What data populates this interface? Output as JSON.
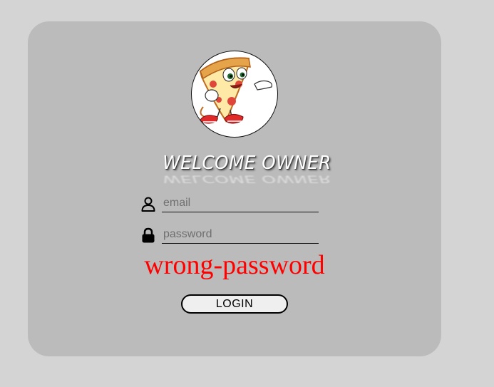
{
  "header": {
    "title": "WELCOME OWNER"
  },
  "logo": {
    "icon": "pizza-mascot-icon"
  },
  "form": {
    "email": {
      "placeholder": "email",
      "value": "",
      "icon": "user-icon"
    },
    "password": {
      "placeholder": "password",
      "value": "",
      "icon": "lock-icon"
    },
    "error_message": "wrong-password",
    "login_label": "LOGIN"
  },
  "colors": {
    "page_background": "#d4d4d4",
    "card_background": "#bbbbbb",
    "error_text": "#ff0000",
    "button_background": "#efefef"
  }
}
